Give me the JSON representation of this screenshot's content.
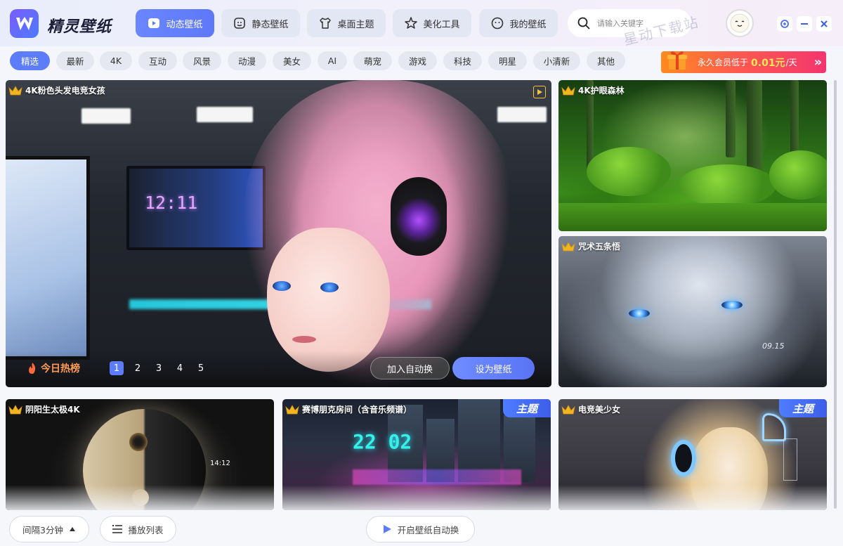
{
  "app": {
    "name": "精灵壁纸",
    "watermark": "星动下载站"
  },
  "nav": [
    {
      "label": "动态壁纸",
      "icon": "play-badge-icon",
      "active": true
    },
    {
      "label": "静态壁纸",
      "icon": "image-face-icon",
      "active": false
    },
    {
      "label": "桌面主题",
      "icon": "tshirt-icon",
      "active": false
    },
    {
      "label": "美化工具",
      "icon": "magic-star-icon",
      "active": false
    },
    {
      "label": "我的壁纸",
      "icon": "smile-icon",
      "active": false
    }
  ],
  "search": {
    "placeholder": "请输入关键字",
    "icon": "search-icon"
  },
  "window_controls": [
    "settings-icon",
    "minimize-icon",
    "close-icon"
  ],
  "categories": [
    "精选",
    "最新",
    "4K",
    "互动",
    "风景",
    "动漫",
    "美女",
    "AI",
    "萌宠",
    "游戏",
    "科技",
    "明星",
    "小清新",
    "其他"
  ],
  "active_category": "精选",
  "vip_banner": {
    "text": "永久会员低于",
    "price": "0.01元",
    "unit": "/天",
    "arrow": "»"
  },
  "hero": {
    "title": "4K粉色头发电竞女孩",
    "clock_text": "12:11",
    "hot_label": "今日热榜",
    "pages": [
      "1",
      "2",
      "3",
      "4",
      "5"
    ],
    "active_page": "1",
    "auto_button": "加入自动换",
    "set_button": "设为壁纸"
  },
  "cards": [
    {
      "title": "4K护眼森林",
      "theme": false
    },
    {
      "title": "咒术五条悟",
      "theme": false,
      "overlay_text": "09.15"
    },
    {
      "title": "阴阳生太极4K",
      "theme": false,
      "overlay_text": "14:12"
    },
    {
      "title": "赛博朋克房间（含音乐频谱）",
      "theme": true,
      "overlay_text": "22 02"
    },
    {
      "title": "电竞美少女",
      "theme": true
    }
  ],
  "theme_badge": "主题",
  "footer": {
    "interval": "间隔3分钟",
    "playlist": "播放列表",
    "auto_toggle": "开启壁纸自动换"
  },
  "colors": {
    "accent": "#5d7cf9",
    "vip_start": "#ff8a1f",
    "vip_end": "#f4356f",
    "crown": "#f3b51e"
  }
}
